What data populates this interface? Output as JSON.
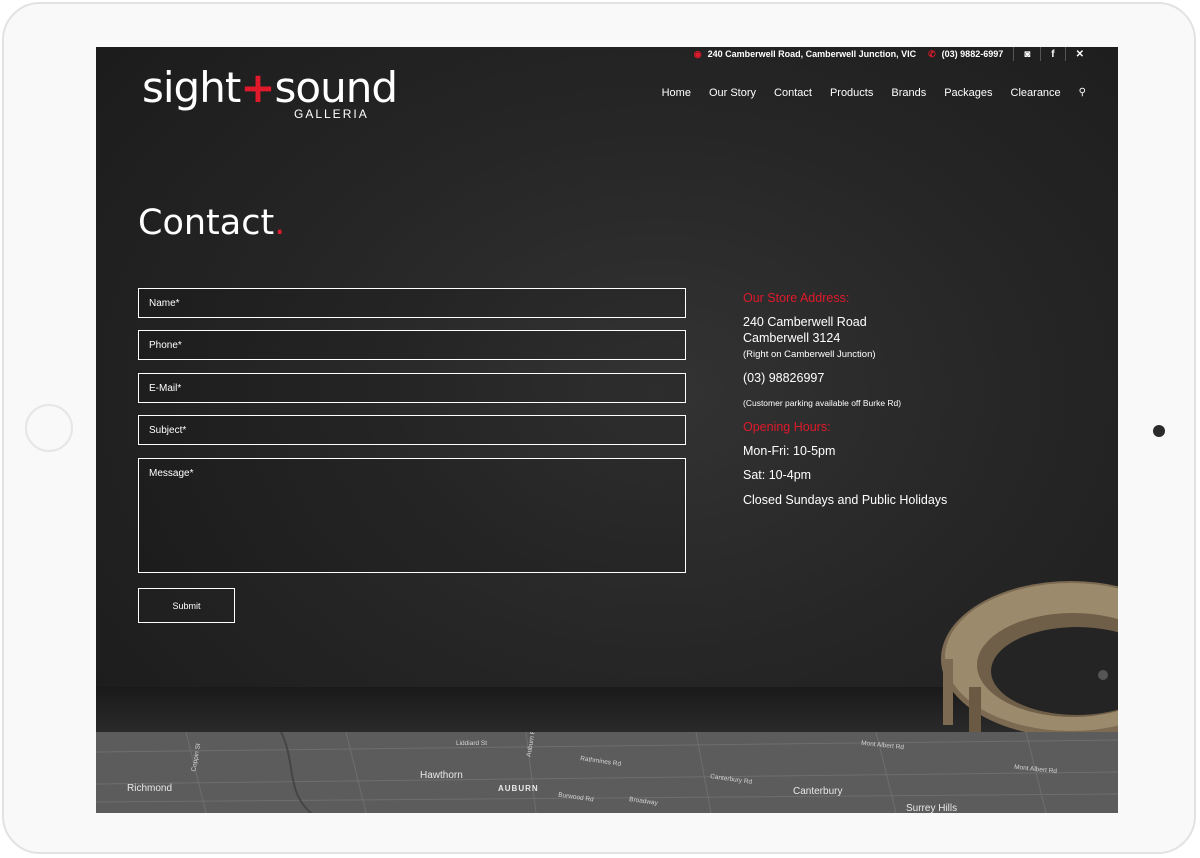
{
  "topbar": {
    "address": "240 Camberwell Road, Camberwell Junction, VIC",
    "phone": "(03) 9882-6997",
    "icons": [
      "instagram-icon",
      "facebook-icon",
      "xing-icon"
    ],
    "social_glyphs": [
      "◙",
      "f",
      "✕"
    ]
  },
  "logo": {
    "text_left": "sight",
    "text_plus": "+",
    "text_right": "sound",
    "subtitle": "GALLERIA"
  },
  "nav": {
    "items": [
      "Home",
      "Our Story",
      "Contact",
      "Products",
      "Brands",
      "Packages",
      "Clearance"
    ],
    "search_glyph": "⚲"
  },
  "page": {
    "title": "Contact",
    "title_dot": "."
  },
  "form": {
    "name_placeholder": "Name*",
    "phone_placeholder": "Phone*",
    "email_placeholder": "E-Mail*",
    "subject_placeholder": "Subject*",
    "message_placeholder": "Message*",
    "submit_label": "Submit"
  },
  "info": {
    "address_heading": "Our Store Address:",
    "street": "240 Camberwell Road",
    "suburb": "Camberwell 3124",
    "location_note": "(Right on Camberwell Junction)",
    "phone": "(03) 98826997",
    "parking_note": "(Customer parking available off Burke Rd)",
    "hours_heading": "Opening Hours:",
    "weekday_hours": "Mon-Fri: 10-5pm",
    "saturday_hours": "Sat: 10-4pm",
    "closed_note": "Closed Sundays and Public Holidays"
  },
  "map": {
    "places": [
      "Richmond",
      "Hawthorn",
      "AUBURN",
      "Canterbury",
      "Surrey Hills"
    ],
    "streets": [
      "Coppin St",
      "Liddiard St",
      "Auburn Rd",
      "Rathmines Rd",
      "Burwood Rd",
      "Broadway",
      "Canterbury Rd",
      "Mont Albert Rd",
      "Mont Albert Rd"
    ]
  },
  "colors": {
    "accent": "#e0192b",
    "background": "#262626",
    "text": "#ffffff",
    "map": "#5c5c5c"
  }
}
